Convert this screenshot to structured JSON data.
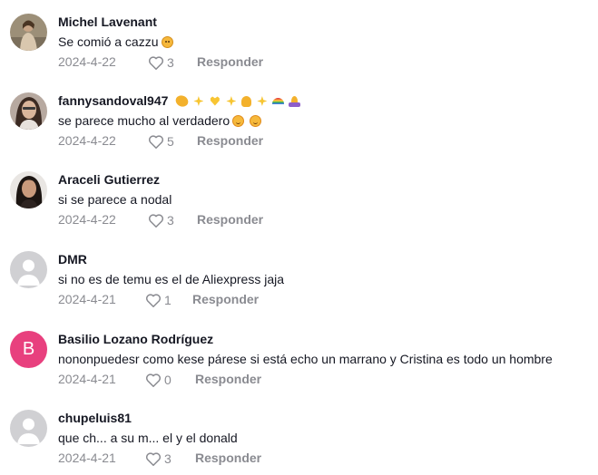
{
  "comments": [
    {
      "username": "Michel Lavenant",
      "text": "Se comió a cazzu",
      "date": "2024-4-22",
      "likes": "3",
      "reply_label": "Responder"
    },
    {
      "username": "fannysandoval947",
      "text": "se parece mucho al verdadero",
      "date": "2024-4-22",
      "likes": "5",
      "reply_label": "Responder"
    },
    {
      "username": "Araceli Gutierrez",
      "text": "si se parece a nodal",
      "date": "2024-4-22",
      "likes": "3",
      "reply_label": "Responder"
    },
    {
      "username": "DMR",
      "text": "si no es de temu es el de Aliexpress jaja",
      "date": "2024-4-21",
      "likes": "1",
      "reply_label": "Responder"
    },
    {
      "username": "Basilio Lozano Rodríguez",
      "avatar_letter": "B",
      "text": "nononpuedesr como kese párese si está echo un marrano y Cristina es todo un hombre",
      "date": "2024-4-21",
      "likes": "0",
      "reply_label": "Responder"
    },
    {
      "username": "chupeluis81",
      "text": "que ch... a su m... el y el donald",
      "date": "2024-4-21",
      "likes": "3",
      "reply_label": "Responder"
    }
  ],
  "colors": {
    "text_primary": "#161823",
    "text_secondary": "#8a8b91",
    "avatar_placeholder": "#d0d0d3",
    "avatar_letter_bg": "#e8407e"
  },
  "icons": {
    "like": "heart-outline-icon",
    "placeholder_avatar": "person-silhouette-icon"
  }
}
